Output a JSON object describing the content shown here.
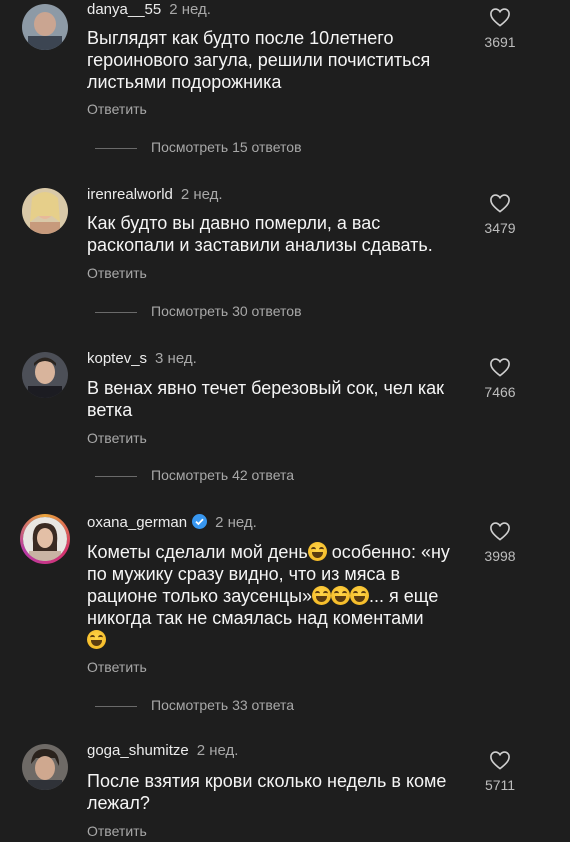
{
  "comments": [
    {
      "username": "danya__55",
      "time": "2 нед.",
      "text": "Выглядят как будто после 10летнего героинового загула, решили почиститься листьями подорожника",
      "likes": "3691",
      "reply_label": "Ответить",
      "view_replies": "Посмотреть 15 ответов"
    },
    {
      "username": "irenrealworld",
      "time": "2 нед.",
      "text": "Как будто вы давно померли, а вас раскопали и заставили анализы сдавать.",
      "likes": "3479",
      "reply_label": "Ответить",
      "view_replies": "Посмотреть 30 ответов"
    },
    {
      "username": "koptev_s",
      "time": "3 нед.",
      "text": "В венах явно течет березовый сок, чел как ветка",
      "likes": "7466",
      "reply_label": "Ответить",
      "view_replies": "Посмотреть 42 ответа"
    },
    {
      "username": "oxana_german",
      "time": "2 нед.",
      "text_parts": [
        "Кометы сделали мой день",
        " особенно: «ну по мужику сразу видно, что из мяса в рационе только заусенцы»",
        "... я еще никогда так не смаялась над коментами"
      ],
      "likes": "3998",
      "reply_label": "Ответить",
      "view_replies": "Посмотреть 33 ответа"
    },
    {
      "username": "goga_shumitze",
      "time": "2 нед.",
      "text": "После взятия крови сколько недель в коме лежал?",
      "likes": "5711",
      "reply_label": "Ответить"
    }
  ],
  "icons": {
    "like": "heart-outline-icon",
    "verified": "verified-badge-icon",
    "emoji": "tears-of-joy-emoji"
  },
  "colors": {
    "background": "#1e1e1e",
    "text": "#f5f5f5",
    "secondary": "#a8a8a8",
    "verified": "#3897f0"
  }
}
